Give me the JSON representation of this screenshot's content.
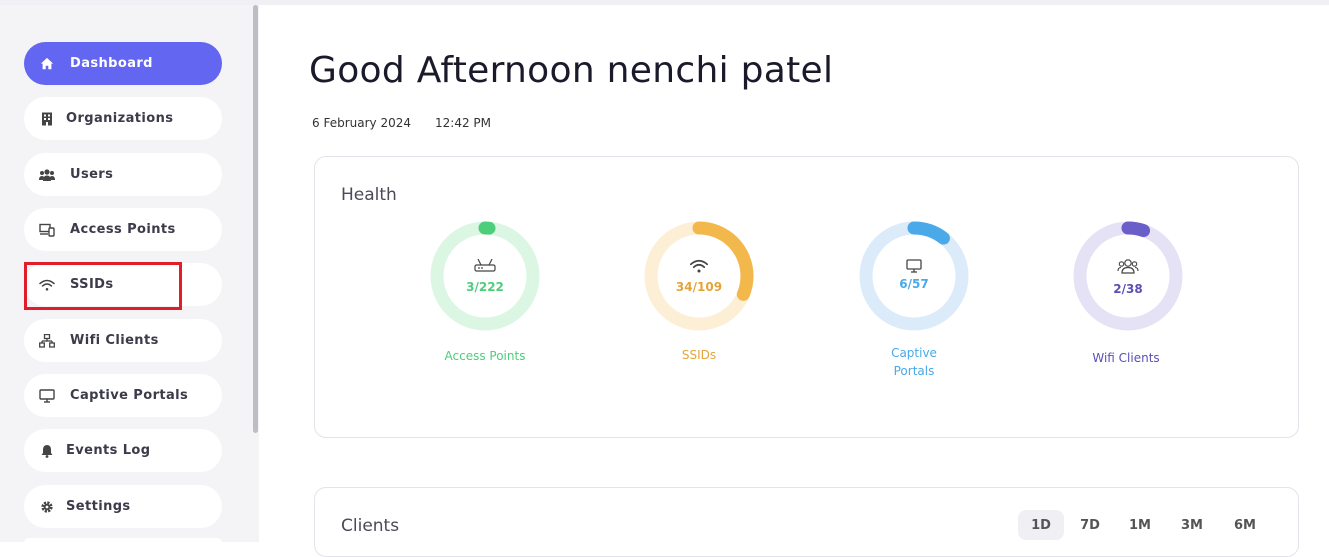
{
  "sidebar": {
    "items": [
      {
        "label": "Dashboard",
        "icon": "home-icon"
      },
      {
        "label": "Organizations",
        "icon": "building-icon"
      },
      {
        "label": "Users",
        "icon": "users-icon"
      },
      {
        "label": "Access Points",
        "icon": "devices-icon"
      },
      {
        "label": "SSIDs",
        "icon": "wifi-icon"
      },
      {
        "label": "Wifi Clients",
        "icon": "network-icon"
      },
      {
        "label": "Captive Portals",
        "icon": "monitor-icon"
      },
      {
        "label": "Events Log",
        "icon": "bell-icon"
      },
      {
        "label": "Settings",
        "icon": "gear-icon"
      }
    ]
  },
  "header": {
    "greeting": "Good Afternoon nenchi patel",
    "date": "6 February 2024",
    "time": "12:42 PM"
  },
  "health": {
    "title": "Health",
    "gauges": [
      {
        "value": "3/222",
        "label": "Access Points",
        "color": "#4cce7b",
        "track": "#dcf6e4",
        "ratio": 0.0135
      },
      {
        "value": "34/109",
        "label": "SSIDs",
        "color": "#f2b84b",
        "track": "#fdefd6",
        "ratio": 0.312
      },
      {
        "value": "6/57",
        "label_line1": "Captive",
        "label_line2": "Portals",
        "color": "#4aa9e8",
        "track": "#dcebfa",
        "ratio": 0.105
      },
      {
        "value": "2/38",
        "label": "Wifi Clients",
        "color": "#6a5fc8",
        "track": "#e6e2f6",
        "ratio": 0.0526
      }
    ]
  },
  "clients": {
    "title": "Clients",
    "tabs": [
      "1D",
      "7D",
      "1M",
      "3M",
      "6M"
    ],
    "active_tab": "1D"
  },
  "colors": {
    "accent": "#6366f1",
    "highlight": "#e11d2a"
  }
}
